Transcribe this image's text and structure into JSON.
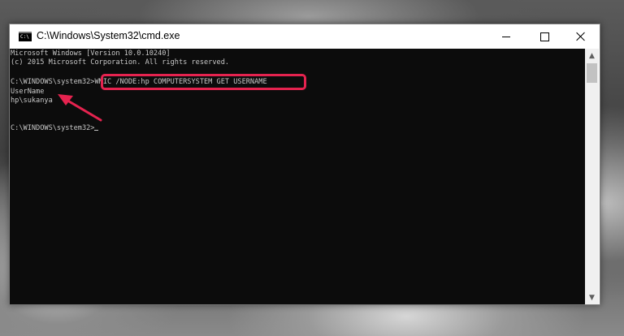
{
  "window": {
    "title": "C:\\Windows\\System32\\cmd.exe",
    "icon": "cmd-icon",
    "icon_glyph": "C:\\",
    "buttons": {
      "minimize_icon": "minimize-icon",
      "maximize_icon": "maximize-icon",
      "close_icon": "close-icon"
    }
  },
  "console": {
    "lines": [
      "Microsoft Windows [Version 10.0.10240]",
      "(c) 2015 Microsoft Corporation. All rights reserved.",
      "",
      "C:\\WINDOWS\\system32>",
      "UserName",
      "hp\\sukanya",
      "",
      "C:\\WINDOWS\\system32>"
    ],
    "command": "WMIC /NODE:hp COMPUTERSYSTEM GET USERNAME",
    "text_color": "#c8c8c8",
    "background": "#0c0c0c"
  },
  "annotation": {
    "box_color": "#e5234f",
    "arrow_color": "#e5234f"
  },
  "scrollbar": {
    "up_glyph": "▲",
    "down_glyph": "▼"
  }
}
